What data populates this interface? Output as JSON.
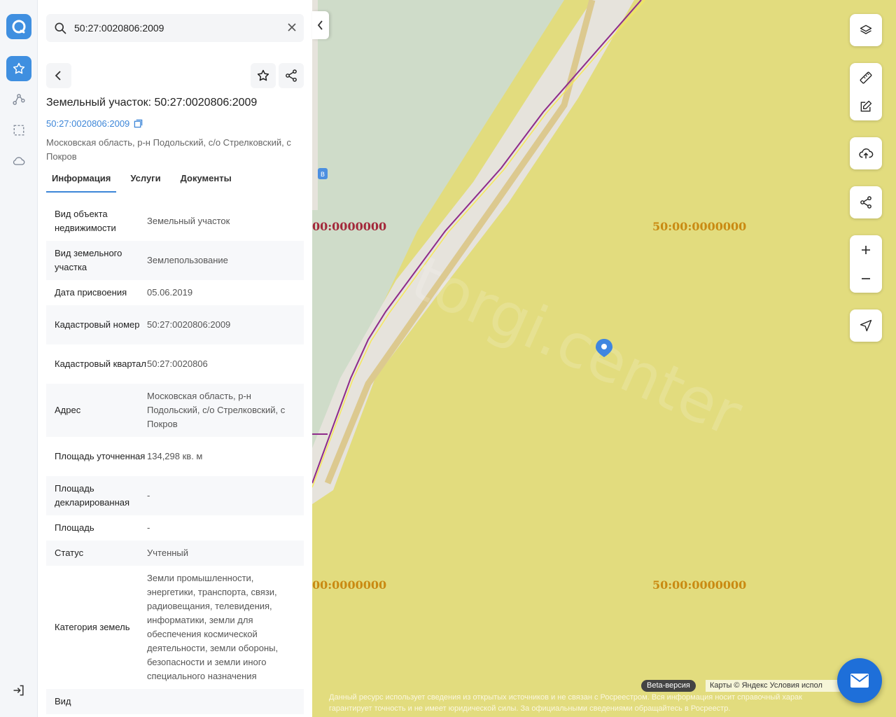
{
  "search": {
    "value": "50:27:0020806:2009"
  },
  "rail": {
    "items": [
      "logo-icon",
      "star-icon",
      "route-icon",
      "selection-icon",
      "cloud-icon",
      "logout-icon"
    ],
    "accent": "#3f8fe0"
  },
  "card": {
    "title": "Земельный участок: 50:27:0020806:2009",
    "cad_link": "50:27:0020806:2009",
    "address_line": "Московская область, р-н Подольский, с/о Стрелковский, с Покров"
  },
  "tabs": [
    {
      "label": "Информация",
      "active": true
    },
    {
      "label": "Услуги",
      "active": false
    },
    {
      "label": "Документы",
      "active": false
    }
  ],
  "info_rows": [
    {
      "key": "Вид объекта недвижимости",
      "value": "Земельный участок"
    },
    {
      "key": "Вид земельного участка",
      "value": "Землепользование"
    },
    {
      "key": "Дата присвоения",
      "value": "05.06.2019"
    },
    {
      "key": "Кадастровый номер",
      "value": "50:27:0020806:2009"
    },
    {
      "key": "Кадастровый квартал",
      "value": "50:27:0020806"
    },
    {
      "key": "Адрес",
      "value": "Московская область, р-н Подольский, с/о Стрелковский, с Покров"
    },
    {
      "key": "Площадь уточненная",
      "value": "134,298 кв. м"
    },
    {
      "key": "Площадь декларированная",
      "value": "-"
    },
    {
      "key": "Площадь",
      "value": "-"
    },
    {
      "key": "Статус",
      "value": "Учтенный"
    },
    {
      "key": "Категория земель",
      "value": "Земли промышленности, энергетики, транспорта, связи, радиовещания, телевидения, информатики, земли для обеспечения космической деятельности, земли обороны, безопасности и земли иного специального назначения"
    },
    {
      "key": "Вид",
      "value": ""
    }
  ],
  "map": {
    "labels": [
      "00:0000000",
      "50:00:0000000",
      "00:0000000",
      "50:00:0000000"
    ],
    "watermark": "torgi.center",
    "beta": "Beta-версия",
    "attribution": "Карты © Яндекс   Условия испол",
    "disclaimer": "Данный ресурс использует сведения из открытых источников и не связан с Росреестром. Вся информация носит справочный харак\nгарантирует точность и не имеет юридической силы. За официальными сведениями обращайтесь в Росреестр.",
    "controls": [
      "layers-icon",
      "ruler-icon",
      "edit-icon",
      "upload-icon",
      "share-icon",
      "zoom-in-icon",
      "zoom-out-icon",
      "locate-icon"
    ],
    "colors": {
      "parcel_fill": "#e2dc7e",
      "border": "#8e2a8a",
      "label_red": "#a3283a",
      "label_gold": "#c98a12",
      "marker": "#3f86e0"
    }
  }
}
